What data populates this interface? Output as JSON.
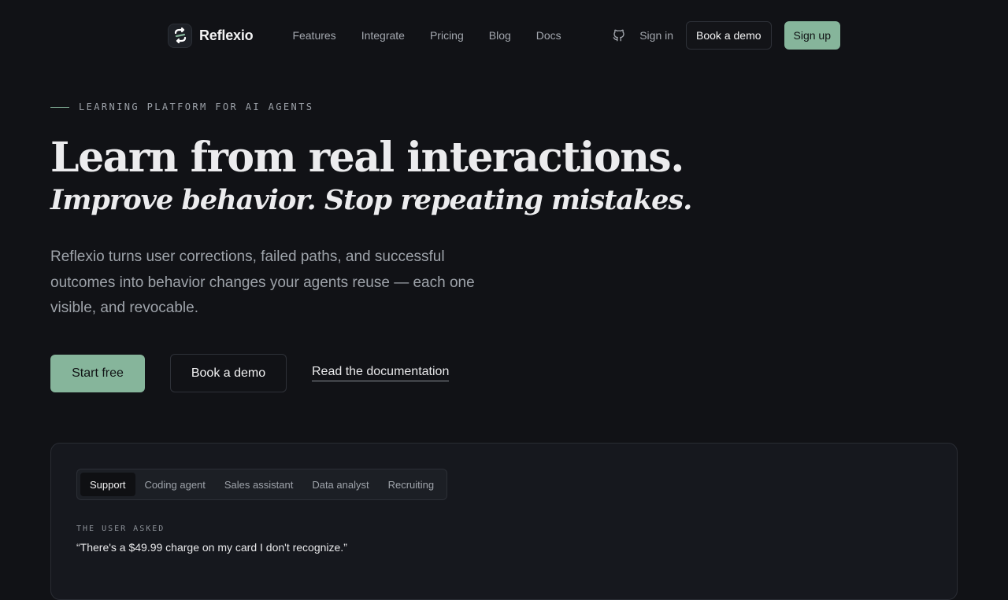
{
  "nav": {
    "brand": "Reflexio",
    "links": [
      "Features",
      "Integrate",
      "Pricing",
      "Blog",
      "Docs"
    ],
    "sign_in": "Sign in",
    "book_demo": "Book a demo",
    "sign_up": "Sign up"
  },
  "hero": {
    "eyebrow": "LEARNING PLATFORM FOR AI AGENTS",
    "title": "Learn from real interactions.",
    "subtitle": "Improve behavior. Stop repeating mistakes.",
    "description": "Reflexio turns user corrections, failed paths, and successful outcomes into behavior changes your agents reuse — each one visible, and revocable.",
    "cta_primary": "Start free",
    "cta_secondary": "Book a demo",
    "cta_link": "Read the documentation"
  },
  "demo": {
    "tabs": [
      "Support",
      "Coding agent",
      "Sales assistant",
      "Data analyst",
      "Recruiting"
    ],
    "active_tab": "Support",
    "asked_label": "THE USER ASKED",
    "asked_quote": "“There's a $49.99 charge on my card I don't recognize.”"
  },
  "colors": {
    "background": "#111216",
    "accent": "#86b59b",
    "panel": "#16181e"
  },
  "icons": {
    "logo": "reflexio-logo-icon",
    "github": "github-icon"
  }
}
